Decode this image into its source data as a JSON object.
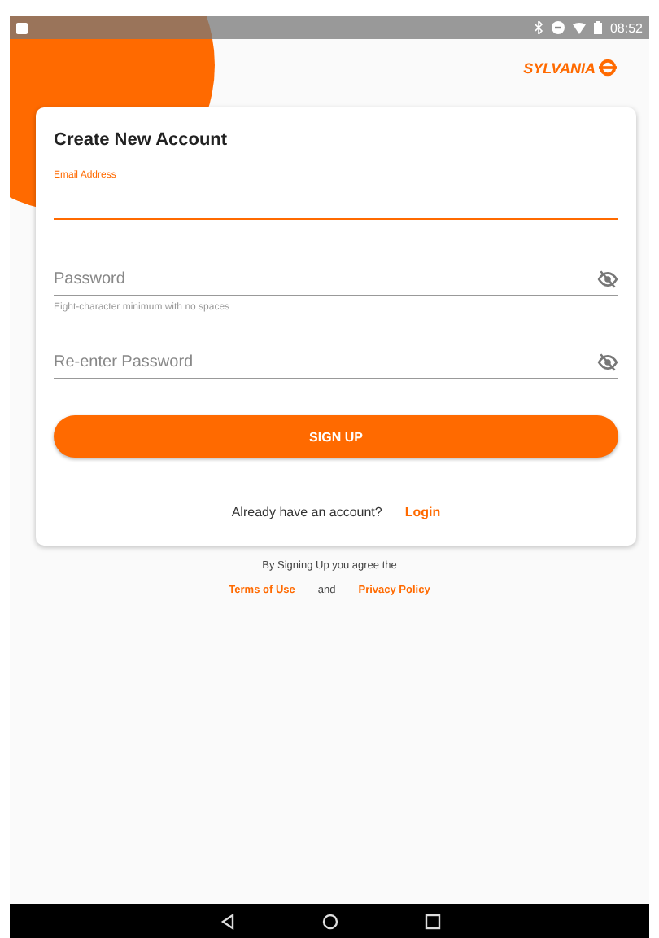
{
  "status_bar": {
    "time": "08:52"
  },
  "logo": {
    "text": "SYLVANIA"
  },
  "card": {
    "title": "Create New Account",
    "fields": [
      {
        "label": "Email Address",
        "focused": true
      },
      {
        "placeholder": "Password",
        "focused": false,
        "helper": "Eight-character minimum with no spaces",
        "visibility_toggle": true
      },
      {
        "placeholder": "Re-enter Password",
        "focused": false,
        "visibility_toggle": true
      }
    ],
    "button": "SIGN UP",
    "login_prompt": "Already have an account?",
    "login_link": "Login"
  },
  "terms": {
    "text": "By Signing Up you agree the",
    "links": [
      {
        "kind": "link",
        "text": "Terms of Use"
      },
      {
        "kind": "plain",
        "text": "and"
      },
      {
        "kind": "link",
        "text": "Privacy Policy"
      }
    ]
  }
}
